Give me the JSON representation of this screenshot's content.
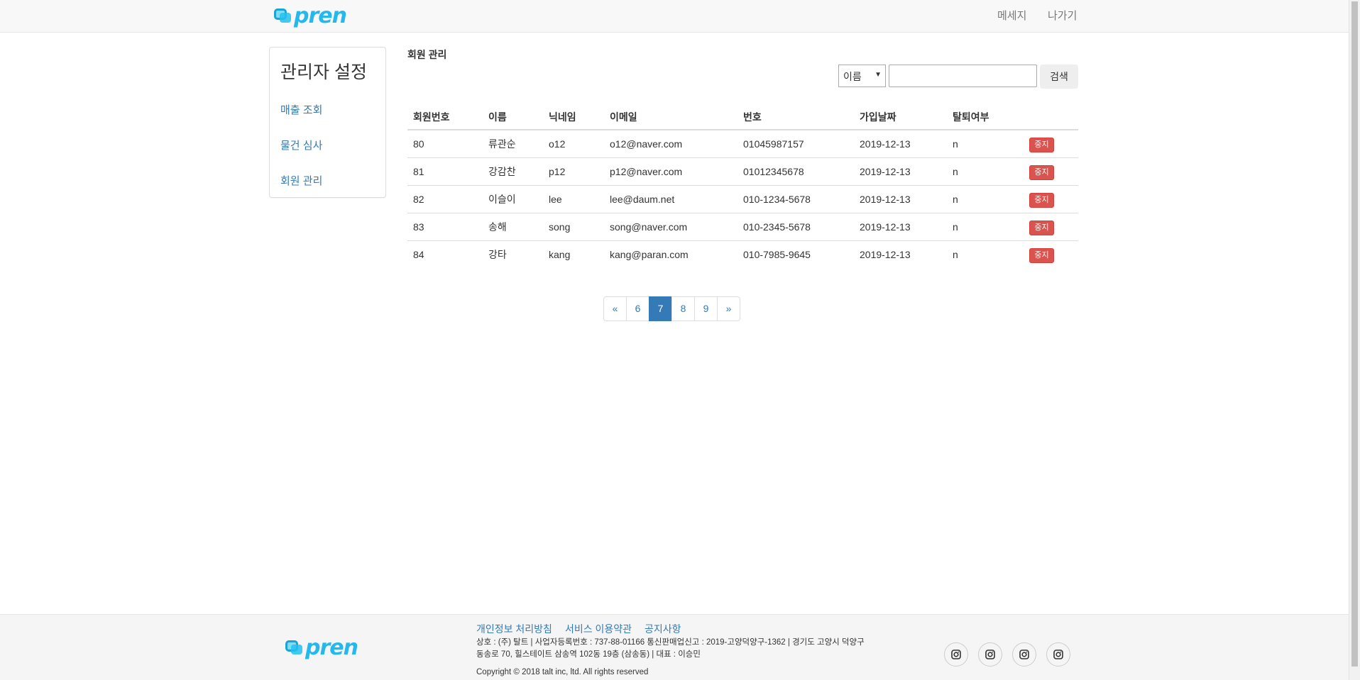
{
  "brand": {
    "logo_text": "pren",
    "accent": "#25b8ec"
  },
  "nav": {
    "message": "메세지",
    "exit": "나가기"
  },
  "sidebar": {
    "title": "관리자 설정",
    "items": [
      {
        "label": "매출 조회"
      },
      {
        "label": "물건 심사"
      },
      {
        "label": "회원 관리"
      }
    ]
  },
  "main": {
    "title": "회원 관리",
    "search": {
      "select_value": "이름",
      "input_value": "",
      "button_label": "검색"
    },
    "table": {
      "headers": [
        "회원번호",
        "이름",
        "닉네임",
        "이메일",
        "번호",
        "가입날짜",
        "탈퇴여부",
        ""
      ],
      "rows": [
        {
          "id": "80",
          "name": "류관순",
          "nick": "o12",
          "email": "o12@naver.com",
          "phone": "01045987157",
          "date": "2019-12-13",
          "withdrawn": "n",
          "action": "중지"
        },
        {
          "id": "81",
          "name": "강감찬",
          "nick": "p12",
          "email": "p12@naver.com",
          "phone": "01012345678",
          "date": "2019-12-13",
          "withdrawn": "n",
          "action": "중지"
        },
        {
          "id": "82",
          "name": "이슬이",
          "nick": "lee",
          "email": "lee@daum.net",
          "phone": "010-1234-5678",
          "date": "2019-12-13",
          "withdrawn": "n",
          "action": "중지"
        },
        {
          "id": "83",
          "name": "송해",
          "nick": "song",
          "email": "song@naver.com",
          "phone": "010-2345-5678",
          "date": "2019-12-13",
          "withdrawn": "n",
          "action": "중지"
        },
        {
          "id": "84",
          "name": "강타",
          "nick": "kang",
          "email": "kang@paran.com",
          "phone": "010-7985-9645",
          "date": "2019-12-13",
          "withdrawn": "n",
          "action": "중지"
        }
      ]
    },
    "pagination": {
      "prev": "«",
      "pages": [
        "6",
        "7",
        "8",
        "9"
      ],
      "active": "7",
      "next": "»"
    }
  },
  "footer": {
    "links": [
      "개인정보 처리방침",
      "서비스 이용약관",
      "공지사항"
    ],
    "info": "상호 : (주) 탈트 | 사업자등록번호 : 737-88-01166 통신판매업신고 : 2019-고양덕양구-1362 | 경기도 고양시 덕양구 동송로 70, 힐스테이트 삼송역 102동 19층 (삼송동) | 대표 : 이승민",
    "copyright": "Copyright © 2018 talt inc, ltd. All rights reserved",
    "social_icons": [
      "instagram-icon",
      "instagram-icon",
      "instagram-icon",
      "instagram-icon"
    ]
  }
}
